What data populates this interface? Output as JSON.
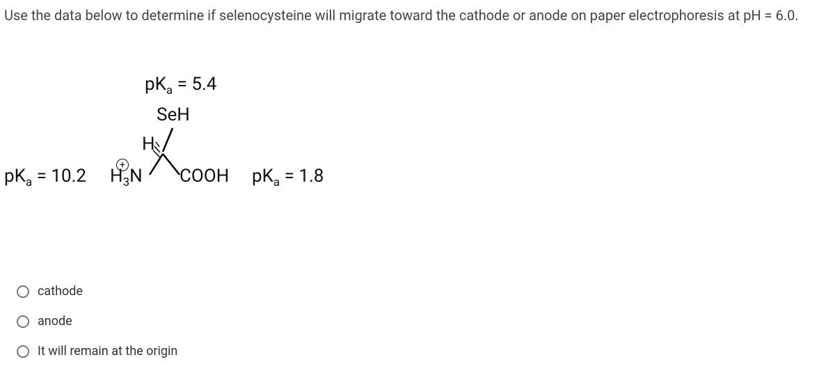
{
  "question": "Use the data below to determine if selenocysteine will migrate toward the cathode or anode on paper electrophoresis at pH = 6.0.",
  "molecule": {
    "pka_seh": "pKₐ = 5.4",
    "seh": "SeH",
    "h": "H",
    "plus": "+",
    "pka_amine": "pKₐ = 10.2",
    "h3n": "H₃N",
    "cooh": "COOH",
    "pka_cooh": "pKₐ = 1.8"
  },
  "options": [
    {
      "label": "cathode"
    },
    {
      "label": "anode"
    },
    {
      "label": "It will remain at the origin"
    }
  ]
}
